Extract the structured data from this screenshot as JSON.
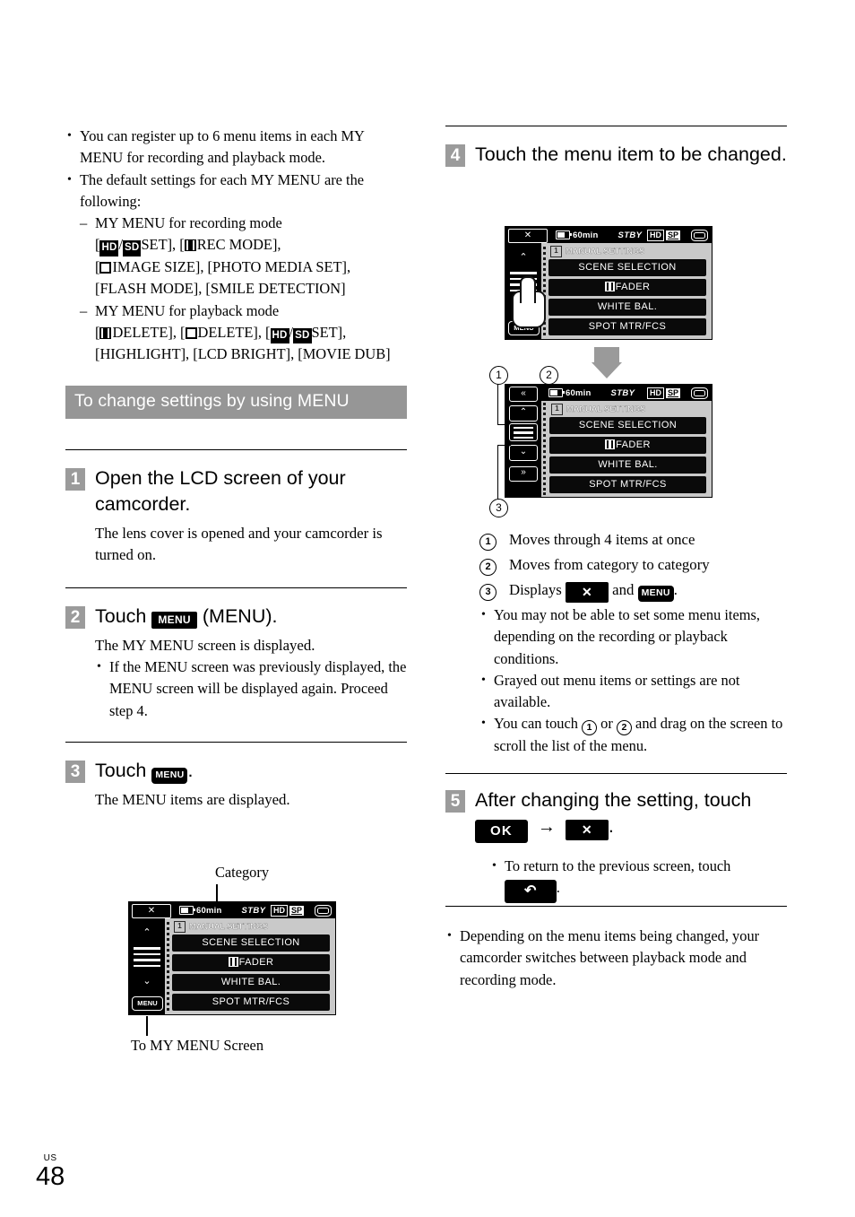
{
  "page": {
    "locale": "US",
    "number": "48"
  },
  "left_column": {
    "intro_bullets": [
      "You can register up to 6 menu items in each MY MENU for recording and playback mode.",
      "The default settings for each MY MENU are the following:"
    ],
    "sub_items": [
      {
        "heading": "MY MENU for recording mode",
        "body_prefix": "[",
        "items_text": "/ SET], [ REC MODE], [ IMAGE SIZE], [PHOTO MEDIA SET], [FLASH MODE], [SMILE DETECTION]"
      },
      {
        "heading": "MY MENU for playback mode",
        "items_text": "[ DELETE], [ DELETE], [ / SET], [HIGHLIGHT], [LCD BRIGHT], [MOVIE DUB]"
      }
    ],
    "recording_tokens": {
      "hd": "HD",
      "sd": "SD",
      "set": "SET",
      "rec_mode": "REC MODE",
      "image_size": "IMAGE SIZE",
      "photo_media_set": "PHOTO MEDIA SET",
      "flash_mode": "FLASH MODE",
      "smile_detection": "SMILE DETECTION"
    },
    "playback_tokens": {
      "delete": "DELETE",
      "highlight": "HIGHLIGHT",
      "lcd_bright": "LCD BRIGHT",
      "movie_dub": "MOVIE DUB"
    },
    "section_header": "To change settings by using MENU",
    "steps": [
      {
        "num": "1",
        "title": "Open the LCD screen of your camcorder.",
        "body": "The lens cover is opened and your camcorder is turned on."
      },
      {
        "num": "2",
        "title_before": "Touch",
        "chip": "MENU",
        "title_after": "(MENU).",
        "body": "The MY MENU screen is displayed.",
        "bullets": [
          "If the MENU screen was previously displayed, the MENU screen will be displayed again. Proceed step 4."
        ]
      },
      {
        "num": "3",
        "title_before": "Touch",
        "chip": "MENU",
        "title_after": ".",
        "body": "The MENU items are displayed."
      }
    ],
    "diagram_caption_top": "Category",
    "diagram_caption_bottom": "To MY MENU Screen"
  },
  "right_column": {
    "steps": [
      {
        "num": "4",
        "title": "Touch the menu item to be changed."
      },
      {
        "num": "5",
        "title_before": "After changing the setting, touch",
        "ok_chip": "OK",
        "arrow": "→",
        "x_chip": "✕",
        "title_after": ".",
        "bullets_before": "To return to the previous screen, touch",
        "back_chip": "↶",
        "bullets_after": "."
      }
    ],
    "legend": [
      {
        "num": "1",
        "text": "Moves through 4 items at once"
      },
      {
        "num": "2",
        "text": "Moves from category to category"
      },
      {
        "num": "3",
        "text_before": "Displays",
        "x_chip": "✕",
        "text_mid": "and",
        "menu_chip": "MENU",
        "text_after": "."
      }
    ],
    "notes": [
      "You may not be able to set some menu items, depending on the recording or playback conditions.",
      "Grayed out menu items or settings are not available.",
      "You can touch ① or ② and drag on the screen to scroll the list of the menu."
    ],
    "note_touch": {
      "prefix": "You can touch",
      "n1": "1",
      "or": "or",
      "n2": "2",
      "suffix": "and drag on the screen to scroll the list of the menu."
    },
    "bottom_note": "Depending on the menu items being changed, your camcorder switches between playback mode and recording mode."
  },
  "lcd": {
    "close_label": "✕",
    "status": {
      "time": "60min",
      "mode": "STBY",
      "quality": "HD",
      "resolution": "SP",
      "media_icon": "memory-card-icon"
    },
    "category": {
      "index": "1",
      "label": "MANUAL SETTINGS"
    },
    "menu_items": [
      {
        "label": "SCENE SELECTION",
        "icon": null
      },
      {
        "label": "FADER",
        "icon": "film-icon"
      },
      {
        "label": "WHITE BAL.",
        "icon": null
      },
      {
        "label": "SPOT MTR/FCS",
        "icon": null
      }
    ],
    "rail": {
      "up": "⌃",
      "down": "⌄",
      "page_up": "«",
      "page_down": "»",
      "menu_label": "MENU"
    }
  },
  "colors": {
    "section_bar": "#969696",
    "step_badge": "#9b9b9b",
    "lcd_panel": "#c9c9c9",
    "lcd_button": "#0a0a0a",
    "arrow": "#9a9a9a"
  }
}
